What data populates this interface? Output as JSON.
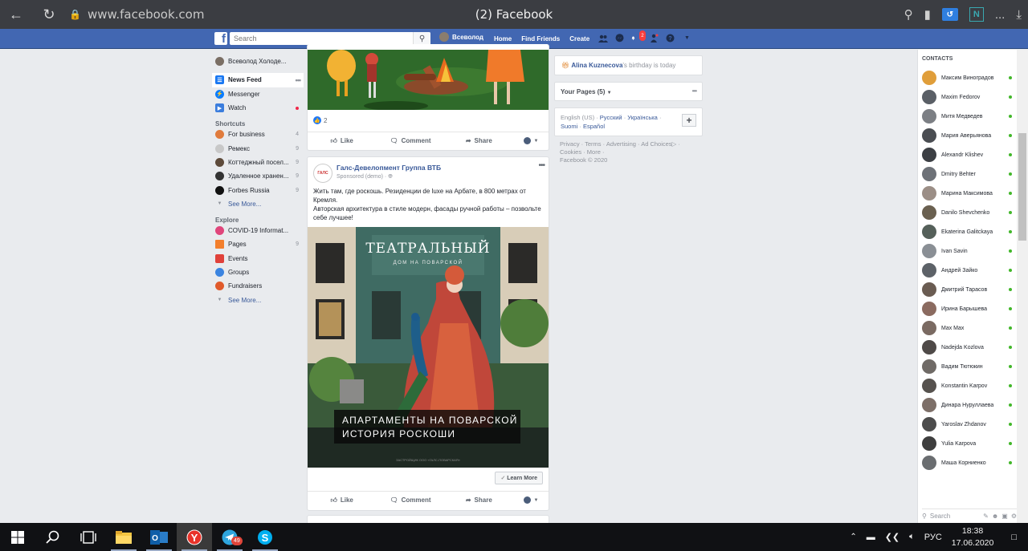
{
  "browser": {
    "url": "www.facebook.com",
    "tab_title": "(2) Facebook",
    "ext_n": "N",
    "menu": "...",
    "colors": {
      "chrome": "#3b3d42",
      "ext_blue": "#2f7fe0",
      "ext_teal": "#3aa8b0"
    }
  },
  "fb_header": {
    "logo": "f",
    "search_placeholder": "Search",
    "user_name": "Всеволод",
    "links": [
      "Home",
      "Find Friends",
      "Create"
    ],
    "notification_count": "2",
    "color": "#4267b2"
  },
  "left_nav": {
    "profile_name": "Всеволод Холоде...",
    "main": [
      {
        "label": "News Feed",
        "icon": "news-feed-icon",
        "color": "#1877f2"
      },
      {
        "label": "Messenger",
        "icon": "messenger-icon",
        "color": "#0a7cff"
      },
      {
        "label": "Watch",
        "icon": "watch-icon",
        "color": "#3b7ddd"
      }
    ],
    "shortcuts_heading": "Shortcuts",
    "shortcuts": [
      {
        "label": "For business",
        "count": "4",
        "color": "#e07b3c"
      },
      {
        "label": "Ремекс",
        "count": "9",
        "color": "#c8c8c8"
      },
      {
        "label": "Коттеджный посел...",
        "count": "9",
        "color": "#5d4a3a"
      },
      {
        "label": "Удаленное хранен...",
        "count": "9",
        "color": "#333333"
      },
      {
        "label": "Forbes Russia",
        "count": "9",
        "color": "#111111"
      }
    ],
    "see_more_1": "See More...",
    "explore_heading": "Explore",
    "explore": [
      {
        "label": "COVID-19 Informat...",
        "count": "",
        "color": "#e0457b"
      },
      {
        "label": "Pages",
        "count": "9",
        "color": "#f37f2c"
      },
      {
        "label": "Events",
        "count": "",
        "color": "#e0413a"
      },
      {
        "label": "Groups",
        "count": "",
        "color": "#3b84e0"
      },
      {
        "label": "Fundraisers",
        "count": "",
        "color": "#e05a2b"
      }
    ],
    "see_more_2": "See More..."
  },
  "post1": {
    "reaction_count": "2",
    "actions": [
      "Like",
      "Comment",
      "Share"
    ]
  },
  "post2": {
    "page_name": "Галс-Девелопмент Группа ВТБ",
    "logo_text": "ГАЛС",
    "sponsored": "Sponsored (demo) ·",
    "text_line1": "Жить там, где роскошь. Резиденции de luxe на Арбате, в 800 метрах от Кремля.",
    "text_line2": "Авторская архитектура в стиле модерн, фасады ручной работы – позвольте себе лучшее!",
    "ad_title": "ТЕАТРАЛЬНЫЙ",
    "ad_subtitle": "ДОМ НА ПОВАРСКОЙ",
    "ad_caption_1": "АПАРТАМЕНТЫ НА ПОВАРСКОЙ",
    "ad_caption_2": "ИСТОРИЯ РОСКОШИ",
    "ad_fine": "ЗАСТРОЙЩИК ООО «ГАЛС-ПОВАРСКАЯ»",
    "learn_more": "Learn More",
    "actions": [
      "Like",
      "Comment",
      "Share"
    ]
  },
  "right": {
    "birthday_name": "Alina Kuznecova",
    "birthday_rest": "'s birthday is today",
    "your_pages": "Your Pages (5)",
    "languages": [
      "English (US)",
      "Русский",
      "Українська",
      "Suomi",
      "Español"
    ],
    "footer_links": [
      "Privacy",
      "Terms",
      "Advertising",
      "Ad Choices",
      "Cookies",
      "More"
    ],
    "copyright": "Facebook © 2020"
  },
  "contacts": {
    "heading": "CONTACTS",
    "list": [
      "Максим Виноградов",
      "Maxim Fedorov",
      "Митя Медведев",
      "Мария Аверьянова",
      "Alexandr Klishev",
      "Dmitry Behter",
      "Марина Максимова",
      "Danilo Shevchenko",
      "Ekaterina Galitckaya",
      "Ivan Savin",
      "Андрей Зайко",
      "Дмитрий Тарасов",
      "Ирина Барышева",
      "Max Max",
      "Nadejda Kozlova",
      "Вадим Тютюкин",
      "Konstantin Karpov",
      "Динара Нуруллаева",
      "Yaroslav Zhdanov",
      "Yulia Karpova",
      "Маша Корниенко"
    ],
    "search_placeholder": "Search"
  },
  "taskbar": {
    "telegram_badge": "49",
    "lang": "РУС",
    "time": "18:38",
    "date": "17.06.2020"
  }
}
